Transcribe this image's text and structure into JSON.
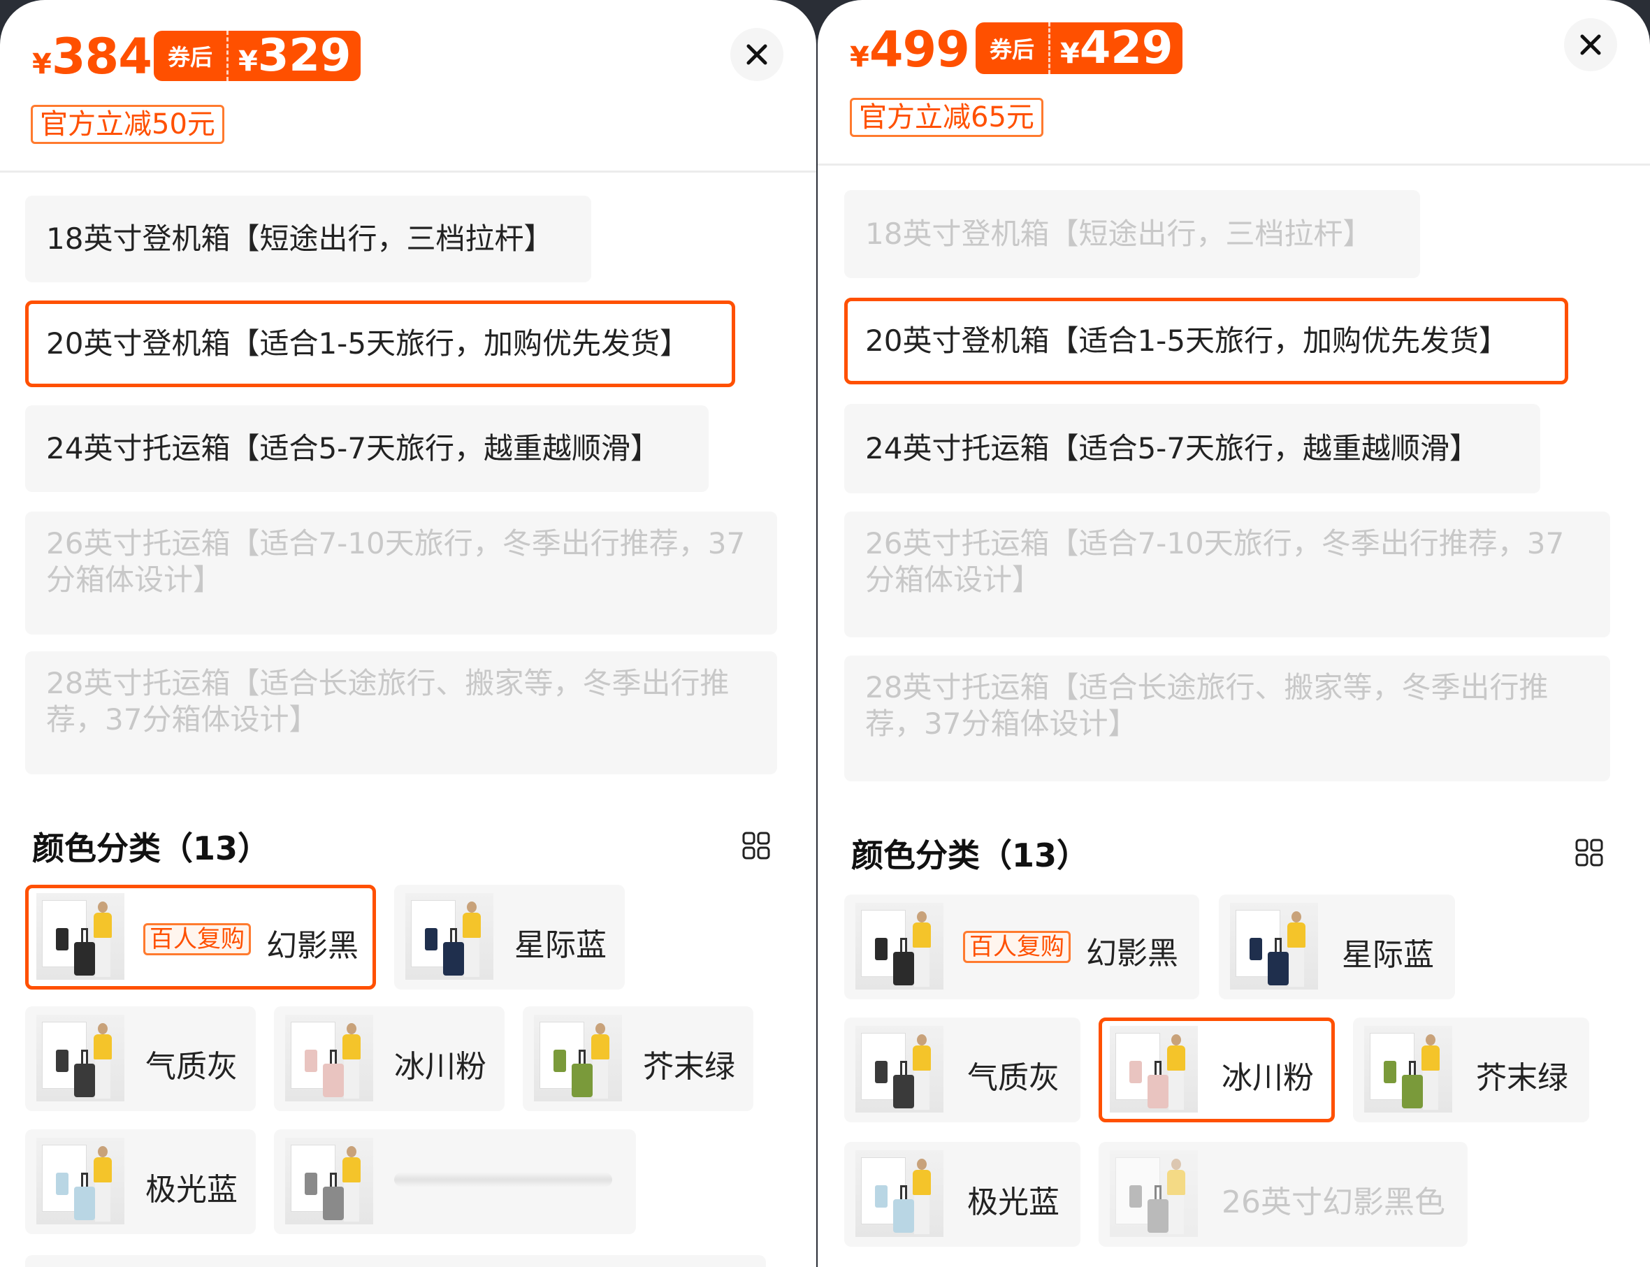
{
  "colors": {
    "accent": "#ff5000",
    "muted_text": "#c8c8c8",
    "option_bg": "#f6f6f6"
  },
  "left": {
    "price": {
      "currency": "¥",
      "value": "384"
    },
    "coupon": {
      "tag": "券后",
      "currency": "¥",
      "value": "329"
    },
    "discount": "官方立减50元",
    "close_icon": "close-icon",
    "options": [
      "18英寸登机箱【短途出行，三档拉杆】",
      "20英寸登机箱【适合1-5天旅行，加购优先发货】",
      "24英寸托运箱【适合5-7天旅行，越重越顺滑】",
      "26英寸托运箱【适合7-10天旅行，冬季出行推荐，37分箱体设计】",
      "28英寸托运箱【适合长途旅行、搬家等，冬季出行推荐，37分箱体设计】"
    ],
    "selected_option": "20英寸登机箱【适合1-5天旅行，加购优先发货】",
    "color_section": {
      "title": "颜色分类（13）",
      "icon": "grid-view-icon"
    },
    "colors": [
      {
        "name": "幻影黑",
        "badge": "百人复购",
        "selected": true,
        "case_color": "#2b2b2b"
      },
      {
        "name": "星际蓝",
        "case_color": "#1f2f4d"
      },
      {
        "name": "气质灰",
        "case_color": "#3a3a3a"
      },
      {
        "name": "冰川粉",
        "case_color": "#e9c4c0"
      },
      {
        "name": "芥末绿",
        "case_color": "#7a9a3a"
      },
      {
        "name": "极光蓝",
        "case_color": "#b9d6e4"
      },
      {
        "name": "",
        "case_color": "#8a8a8a"
      }
    ]
  },
  "right": {
    "price": {
      "currency": "¥",
      "value": "499"
    },
    "coupon": {
      "tag": "券后",
      "currency": "¥",
      "value": "429"
    },
    "discount": "官方立减65元",
    "close_icon": "close-icon",
    "options": [
      "18英寸登机箱【短途出行，三档拉杆】",
      "20英寸登机箱【适合1-5天旅行，加购优先发货】",
      "24英寸托运箱【适合5-7天旅行，越重越顺滑】",
      "26英寸托运箱【适合7-10天旅行，冬季出行推荐，37分箱体设计】",
      "28英寸托运箱【适合长途旅行、搬家等，冬季出行推荐，37分箱体设计】"
    ],
    "selected_option": "20英寸登机箱【适合1-5天旅行，加购优先发货】",
    "color_section": {
      "title": "颜色分类（13）",
      "icon": "grid-view-icon"
    },
    "colors": [
      {
        "name": "幻影黑",
        "badge": "百人复购",
        "case_color": "#2b2b2b"
      },
      {
        "name": "星际蓝",
        "case_color": "#1f2f4d"
      },
      {
        "name": "气质灰",
        "case_color": "#3a3a3a"
      },
      {
        "name": "冰川粉",
        "selected": true,
        "case_color": "#e9c4c0"
      },
      {
        "name": "芥末绿",
        "case_color": "#7a9a3a"
      },
      {
        "name": "极光蓝",
        "case_color": "#b9d6e4"
      },
      {
        "name": "26英寸幻影黑色",
        "disabled": true,
        "case_color": "#8a8a8a"
      }
    ]
  }
}
